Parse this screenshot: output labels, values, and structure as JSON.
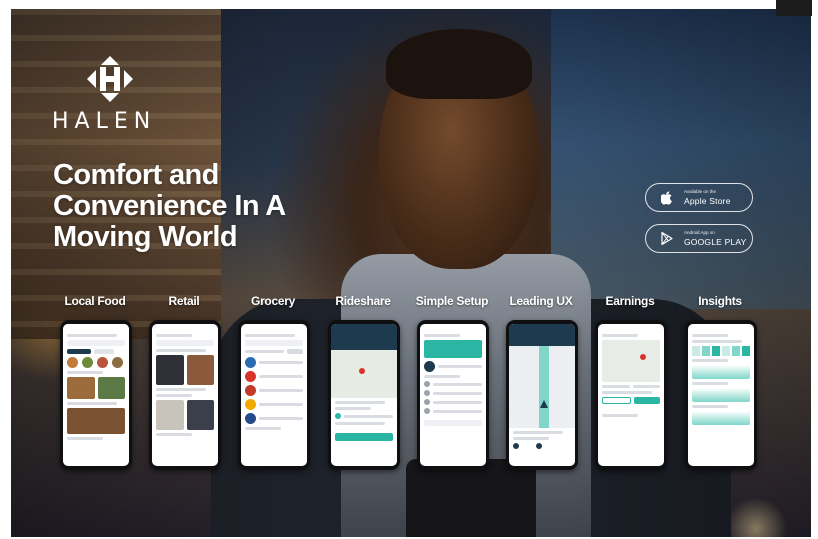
{
  "brand": {
    "name": "HALEN",
    "logo_icon": "halen-h-diamond-logo"
  },
  "headline": {
    "line1": "Comfort and",
    "line2": "Convenience In A",
    "line3": "Moving World"
  },
  "store_buttons": {
    "apple": {
      "small": "Available on the",
      "label": "Apple Store",
      "icon": "apple-icon"
    },
    "google": {
      "small": "Android App on",
      "label": "GOOGLE PLAY",
      "icon": "play-icon"
    }
  },
  "features": [
    {
      "label": "Local Food"
    },
    {
      "label": "Retail"
    },
    {
      "label": "Grocery"
    },
    {
      "label": "Rideshare"
    },
    {
      "label": "Simple Setup"
    },
    {
      "label": "Leading UX"
    },
    {
      "label": "Earnings"
    },
    {
      "label": "Insights"
    }
  ],
  "colors": {
    "accent_teal": "#2bb5a3",
    "dark_navy": "#1e3a4f",
    "text_white": "#ffffff"
  }
}
